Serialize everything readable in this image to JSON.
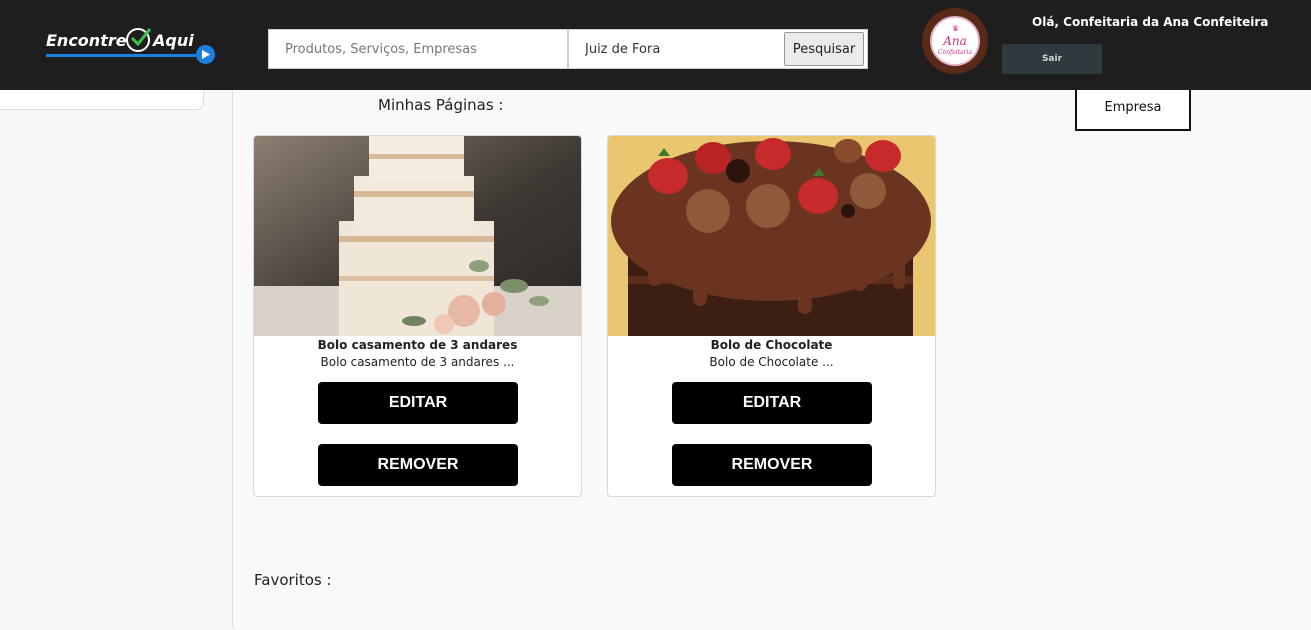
{
  "header": {
    "logo": {
      "word1": "Encontre",
      "word2": "Aqui"
    },
    "search": {
      "placeholder": "Produtos, Serviços, Empresas",
      "value": ""
    },
    "location": {
      "value": "Juiz de Fora"
    },
    "search_button": "Pesquisar",
    "avatar": {
      "brand": "Ana",
      "sub": "Confeitaria"
    },
    "greeting": "Olá, Confeitaria da Ana Confeiteira",
    "logout_label": "Sair"
  },
  "main": {
    "pages_title": "Minhas Páginas :",
    "empresa_button": "Empresa",
    "cards": [
      {
        "title": "Bolo casamento de 3 andares",
        "description": "Bolo casamento de 3 andares ...",
        "image": "naked-wedding-cake-image",
        "edit_label": "EDITAR",
        "remove_label": "REMOVER"
      },
      {
        "title": "Bolo de Chocolate",
        "description": "Bolo de Chocolate ...",
        "image": "chocolate-strawberry-cake-image",
        "edit_label": "EDITAR",
        "remove_label": "REMOVER"
      }
    ],
    "favorites_title": "Favoritos :"
  },
  "colors": {
    "header_bg": "#1e1e1e",
    "accent_blue": "#1a7fe0",
    "check_green": "#3ec24a",
    "button_black": "#000000",
    "logout_bg": "#2f3a3f",
    "page_bg": "#f7f7f7"
  }
}
